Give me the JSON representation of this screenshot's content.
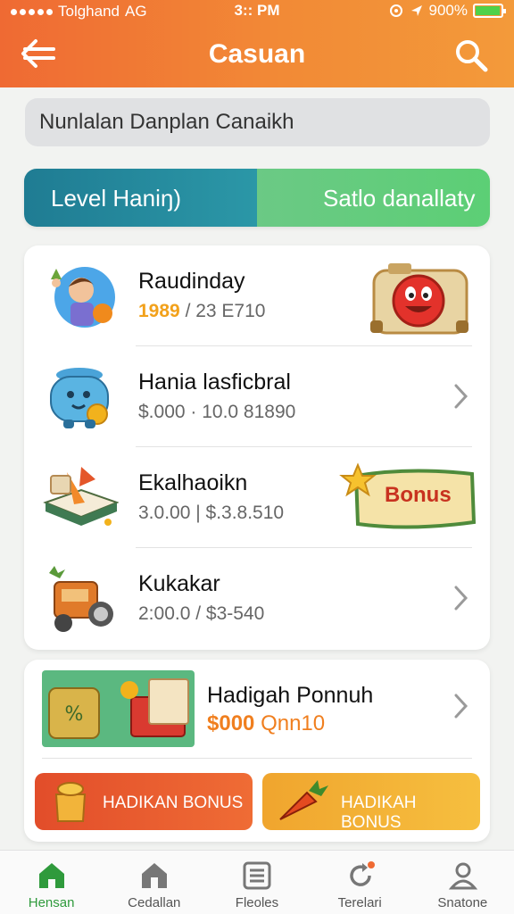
{
  "status_bar": {
    "carrier": "Tolghand",
    "network": "AG",
    "time": "3:: PM",
    "battery": "900%"
  },
  "header": {
    "title": "Casuan"
  },
  "search": {
    "text": "Nunlalan Danplan Canaikh"
  },
  "segment": {
    "left_label": "Level Haniŋ)",
    "right_label": "Satlo danallaty"
  },
  "list": {
    "items": [
      {
        "name": "Raudinday",
        "highlight": "1989",
        "value": "/ 23 E710",
        "icon": "boy-character-icon",
        "badge": "happy-camera-icon"
      },
      {
        "name": "Hania lasficbral",
        "highlight": "",
        "value": "$.000 · 10.0 81890",
        "icon": "blue-pot-icon",
        "badge": "chevron-right-icon"
      },
      {
        "name": "Ekalhaoikn",
        "highlight": "",
        "value": "3.0.00 | $.3.8.510",
        "icon": "book-megaphone-icon",
        "badge": "bonus-ticket-icon",
        "badge_text": "Bonus"
      },
      {
        "name": "Kukakar",
        "highlight": "",
        "value": "2:00.0 / $3-540",
        "icon": "toy-truck-icon",
        "badge": "chevron-right-icon"
      }
    ]
  },
  "promo": {
    "title": "Hadigah Ponnuh",
    "amount": "$000",
    "amount_suffix": "Qnn10",
    "buttons": [
      {
        "label": "HADIKAN BONUS",
        "icon": "gift-bag-icon",
        "color": "#e24d2a"
      },
      {
        "label": "HADIKAH BONUS",
        "icon": "carrot-icon",
        "color": "#f0a52e"
      }
    ]
  },
  "bottom_nav": {
    "tabs": [
      {
        "label": "Hensan",
        "icon": "home-icon",
        "active": true
      },
      {
        "label": "Cedallan",
        "icon": "house-icon",
        "active": false
      },
      {
        "label": "Fleoles",
        "icon": "list-icon",
        "active": false
      },
      {
        "label": "Terelari",
        "icon": "refresh-icon",
        "active": false
      },
      {
        "label": "Snatone",
        "icon": "profile-icon",
        "active": false
      }
    ]
  },
  "colors": {
    "header_orange": "#ef6a33",
    "teal": "#1f7c93",
    "green": "#5ccf75",
    "active_tab": "#2f9a3c"
  }
}
